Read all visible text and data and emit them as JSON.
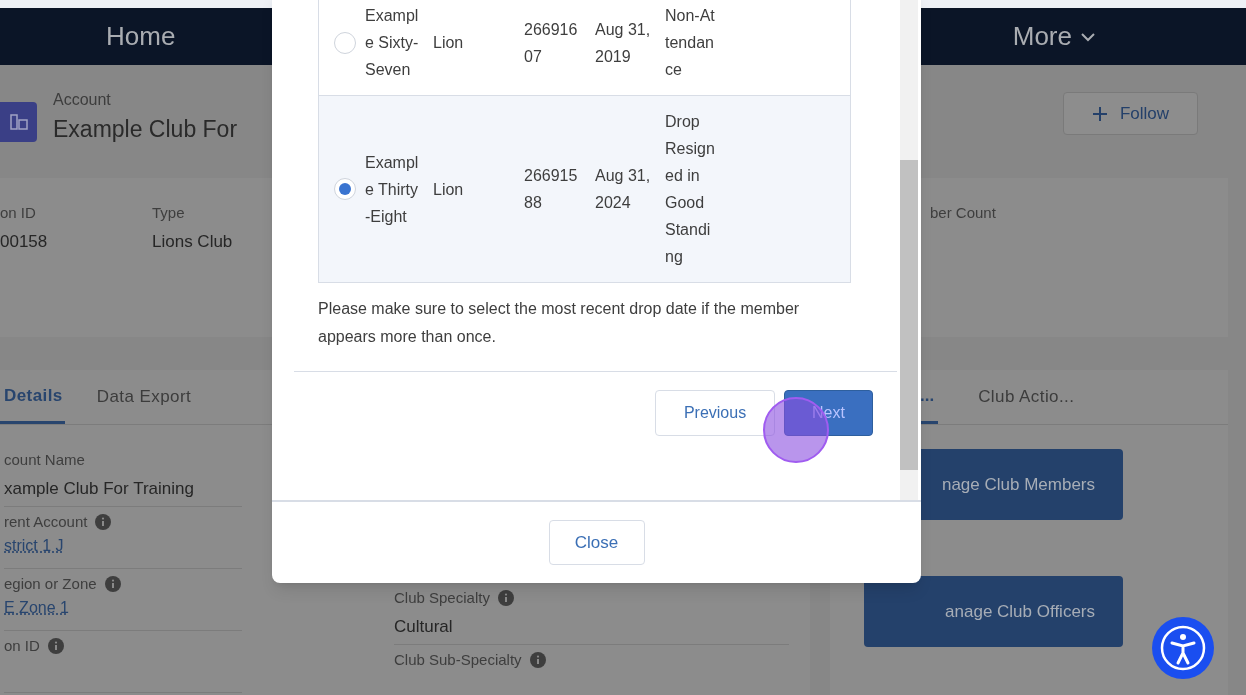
{
  "nav": {
    "items": [
      {
        "label": "Home",
        "kind": "link"
      },
      {
        "label": "More",
        "kind": "menu"
      }
    ]
  },
  "record": {
    "object_type": "Account",
    "title": "Example Club For",
    "follow_label": "Follow"
  },
  "highlights": [
    {
      "label": "on ID",
      "value": "00158"
    },
    {
      "label": "Type",
      "value": "Lions Club"
    },
    {
      "label": "ber Count"
    }
  ],
  "detail_tabs": [
    {
      "label": "Details",
      "selected": true
    },
    {
      "label": "Data Export",
      "selected": false
    }
  ],
  "fields_left": [
    {
      "label": "count Name",
      "value": "xample Club For Training",
      "kind": "text",
      "info": false
    },
    {
      "label": "rent Account",
      "value": "strict 1 J",
      "kind": "link",
      "info": true
    },
    {
      "label": "egion or Zone",
      "value": "E Zone 1",
      "kind": "link",
      "info": true
    },
    {
      "label": "on ID",
      "info": true
    }
  ],
  "fields_right": [
    {
      "label": "Club Specialty",
      "value": "Cultural",
      "kind": "text",
      "info": true
    },
    {
      "label": "Club Sub-Specialty",
      "info": true
    }
  ],
  "side_tabs": [
    {
      "label": "...",
      "selected": true
    },
    {
      "label": "Club Actio...",
      "selected": false
    }
  ],
  "side_buttons": [
    "nage Club Members",
    "anage Club Officers"
  ],
  "modal": {
    "rows": [
      {
        "selected": false,
        "name": "Example Sixty-Seven",
        "type": "Lion",
        "id": "26691607",
        "date": "Aug 31, 2019",
        "reason": "Non-Attendance"
      },
      {
        "selected": true,
        "name": "Example Thirty-Eight",
        "type": "Lion",
        "id": "26691588",
        "date": "Aug 31, 2024",
        "reason": "Drop Resigned in Good Standing"
      }
    ],
    "note": "Please make sure to select the most recent drop date if the member appears more than once.",
    "previous_label": "Previous",
    "next_label": "Next",
    "close_label": "Close"
  }
}
